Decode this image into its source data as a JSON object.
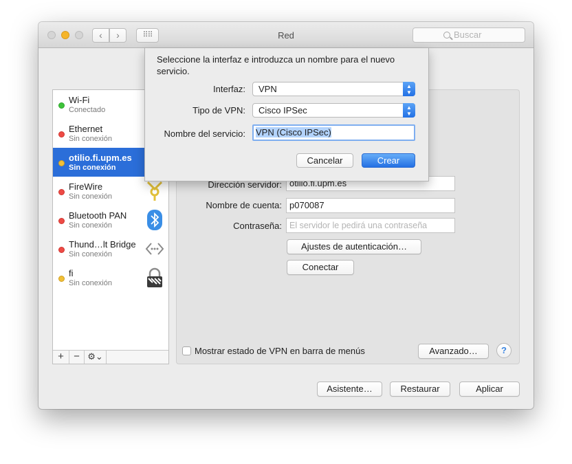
{
  "window": {
    "title": "Red",
    "search_placeholder": "Buscar"
  },
  "services": [
    {
      "name": "Wi-Fi",
      "status": "Conectado",
      "status_color": "green",
      "icon": "wifi-icon",
      "selected": false
    },
    {
      "name": "Ethernet",
      "status": "Sin conexión",
      "status_color": "red",
      "icon": "ethernet-icon",
      "selected": false
    },
    {
      "name": "otilio.fi.upm.es",
      "status": "Sin conexión",
      "status_color": "yellow",
      "icon": "vpn-icon",
      "selected": true
    },
    {
      "name": "FireWire",
      "status": "Sin conexión",
      "status_color": "red",
      "icon": "firewire-icon",
      "selected": false
    },
    {
      "name": "Bluetooth PAN",
      "status": "Sin conexión",
      "status_color": "red",
      "icon": "bluetooth-icon",
      "selected": false
    },
    {
      "name": "Thund…lt Bridge",
      "status": "Sin conexión",
      "status_color": "red",
      "icon": "thunderbolt-bridge-icon",
      "selected": false
    },
    {
      "name": "fi",
      "status": "Sin conexión",
      "status_color": "yellow",
      "icon": "vpn-lock-icon",
      "selected": false
    }
  ],
  "sidebar_tools": {
    "add": "+",
    "remove": "−",
    "gear": "⚙⌄"
  },
  "detail": {
    "server_label": "Dirección servidor:",
    "server_value": "otilio.fi.upm.es",
    "account_label": "Nombre de cuenta:",
    "account_value": "p070087",
    "password_label": "Contraseña:",
    "password_placeholder": "El servidor le pedirá una contraseña",
    "auth_button": "Ajustes de autenticación…",
    "connect_button": "Conectar",
    "show_vpn_status_label": "Mostrar estado de VPN en barra de menús",
    "show_vpn_status_checked": false,
    "advanced_button": "Avanzado…",
    "help_button": "?"
  },
  "footer": {
    "assistant_button": "Asistente…",
    "revert_button": "Restaurar",
    "apply_button": "Aplicar"
  },
  "sheet": {
    "intro": "Seleccione la interfaz e introduzca un nombre para el nuevo servicio.",
    "interface_label": "Interfaz:",
    "interface_value": "VPN",
    "vpn_type_label": "Tipo de VPN:",
    "vpn_type_value": "Cisco IPSec",
    "service_name_label": "Nombre del servicio:",
    "service_name_value": "VPN (Cisco IPSec)",
    "cancel_button": "Cancelar",
    "create_button": "Crear"
  },
  "colors": {
    "selection": "#2b6ed9",
    "status_green": "#3ec43a",
    "status_red": "#ee4b45",
    "status_yellow": "#f2c036",
    "accent_button": "#2470e3"
  }
}
